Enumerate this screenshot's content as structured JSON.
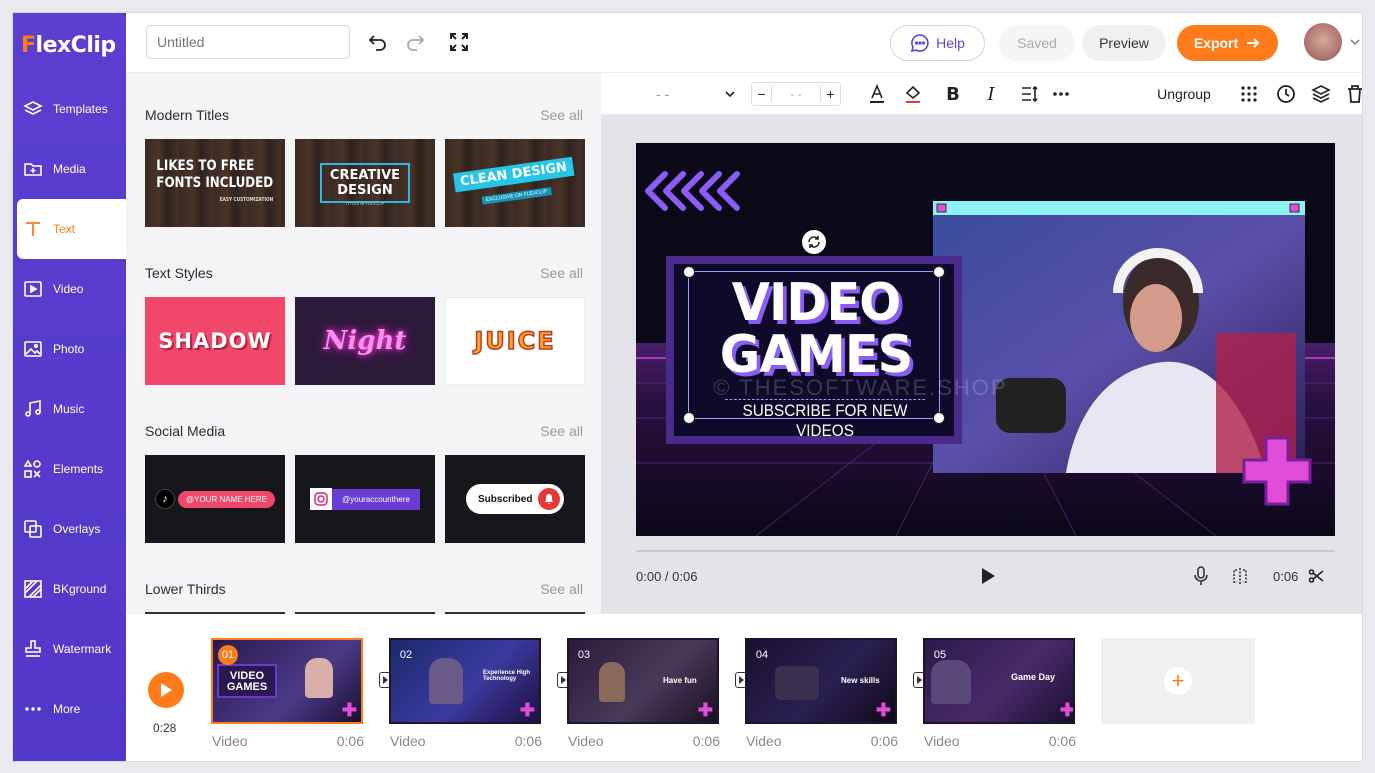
{
  "app": {
    "logo_prefix": "F",
    "logo_rest": "lexClip"
  },
  "sidebar": {
    "items": [
      {
        "label": "Templates",
        "icon": "layers-icon"
      },
      {
        "label": "Media",
        "icon": "folder-plus-icon"
      },
      {
        "label": "Text",
        "icon": "text-t-icon",
        "active": true
      },
      {
        "label": "Video",
        "icon": "video-icon"
      },
      {
        "label": "Photo",
        "icon": "image-icon"
      },
      {
        "label": "Music",
        "icon": "music-icon"
      },
      {
        "label": "Elements",
        "icon": "shapes-icon"
      },
      {
        "label": "Overlays",
        "icon": "overlay-icon"
      },
      {
        "label": "BKground",
        "icon": "background-icon"
      },
      {
        "label": "Watermark",
        "icon": "stamp-icon"
      },
      {
        "label": "More",
        "icon": "more-dots-icon"
      }
    ]
  },
  "topbar": {
    "title_placeholder": "Untitled",
    "help": "Help",
    "saved": "Saved",
    "preview": "Preview",
    "export": "Export"
  },
  "panel": {
    "sections": [
      {
        "title": "Modern Titles",
        "see_all": "See all",
        "items": [
          {
            "line1": "LIKES TO FREE",
            "line2": "FONTS INCLUDED",
            "sub": "EASY CUSTOMIZATION"
          },
          {
            "line1": "CREATIVE",
            "line2": "DESIGN",
            "sub": "TITLES IN FLEXCLIP"
          },
          {
            "line1": "CLEAN DESIGN",
            "line2": "",
            "sub": "EXCLUSIVE ON FLEXCLIP"
          }
        ]
      },
      {
        "title": "Text Styles",
        "see_all": "See all",
        "items": [
          {
            "text": "SHADOW"
          },
          {
            "text": "Night"
          },
          {
            "text": "JUICE"
          }
        ]
      },
      {
        "title": "Social Media",
        "see_all": "See all",
        "items": [
          {
            "text": "@YOUR NAME HERE"
          },
          {
            "text": "@youraccounthere"
          },
          {
            "text": "Subscribed"
          }
        ]
      },
      {
        "title": "Lower Thirds",
        "see_all": "See all",
        "items": []
      }
    ]
  },
  "toolbar": {
    "font_select": "- -",
    "font_size": "- -",
    "ungroup": "Ungroup"
  },
  "canvas": {
    "title1": "VIDEO",
    "title2": "GAMES",
    "subtitle": "SUBSCRIBE FOR NEW VIDEOS",
    "watermark": "© THESOFTWARE.SHOP"
  },
  "player": {
    "time": "0:00 / 0:06",
    "duration": "0:06"
  },
  "timeline": {
    "total": "0:28",
    "clips": [
      {
        "num": "01",
        "label": "Video",
        "duration": "0:06",
        "caption": "VIDEO GAMES"
      },
      {
        "num": "02",
        "label": "Video",
        "duration": "0:06",
        "caption": "Experience High Technology"
      },
      {
        "num": "03",
        "label": "Video",
        "duration": "0:06",
        "caption": "Have fun"
      },
      {
        "num": "04",
        "label": "Video",
        "duration": "0:06",
        "caption": "New skills"
      },
      {
        "num": "05",
        "label": "Video",
        "duration": "0:06",
        "caption": "Game Day"
      }
    ]
  },
  "colors": {
    "brand_purple": "#5a3fd1",
    "accent_orange": "#ff7a1a"
  }
}
